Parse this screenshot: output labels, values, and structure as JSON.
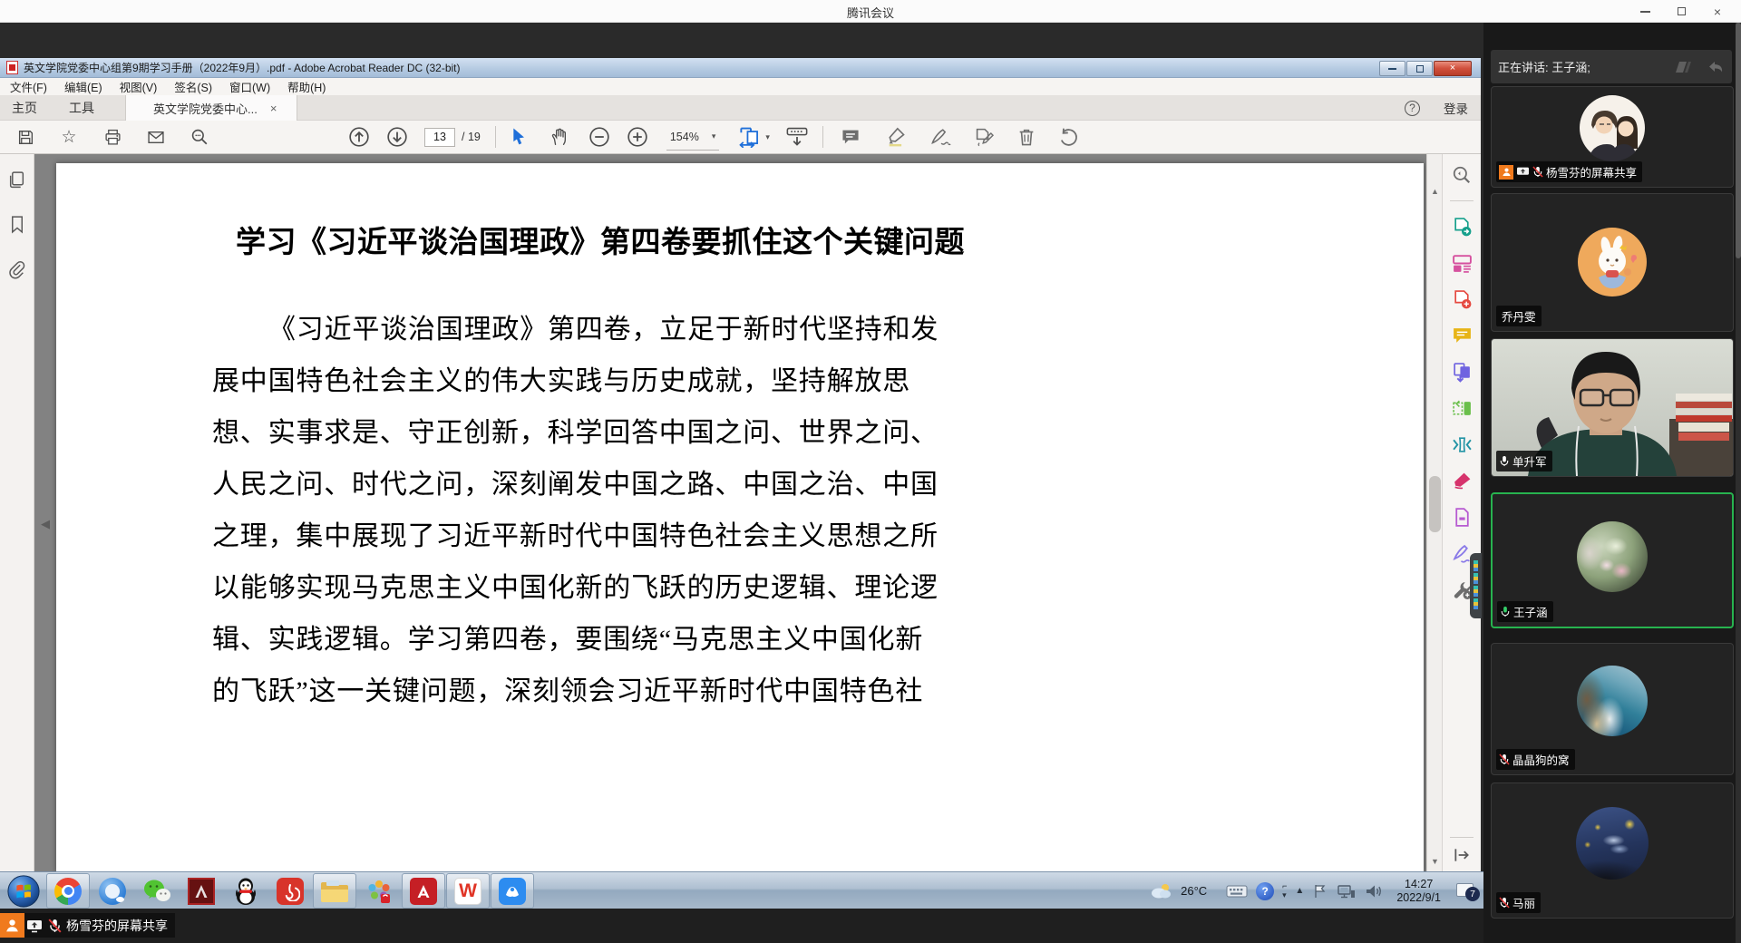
{
  "meeting": {
    "window_title": "腾讯会议",
    "speaking_label": "正在讲话: 王子涵;",
    "share_banner": "杨雪芬的屏幕共享"
  },
  "participants": [
    {
      "name": "杨雪芬的屏幕共享",
      "mic": "muted",
      "role": "sharing-host"
    },
    {
      "name": "乔丹雯",
      "mic": "none"
    },
    {
      "name": "单升军",
      "mic": "on"
    },
    {
      "name": "王子涵",
      "mic": "speaking"
    },
    {
      "name": "晶晶狗的窝",
      "mic": "muted"
    },
    {
      "name": "马丽",
      "mic": "muted"
    }
  ],
  "acrobat": {
    "window_title": "英文学院党委中心组第9期学习手册（2022年9月）.pdf - Adobe Acrobat Reader DC (32-bit)",
    "menus": [
      "文件(F)",
      "编辑(E)",
      "视图(V)",
      "签名(S)",
      "窗口(W)",
      "帮助(H)"
    ],
    "tab_home": "主页",
    "tab_tools": "工具",
    "tab_document": "英文学院党委中心...",
    "sign_in": "登录",
    "page_current": "13",
    "page_total": "/ 19",
    "zoom_level": "154%"
  },
  "document": {
    "title": "学习《习近平谈治国理政》第四卷要抓住这个关键问题",
    "lines": [
      "《习近平谈治国理政》第四卷，立足于新时代坚持和发",
      "展中国特色社会主义的伟大实践与历史成就，坚持解放思",
      "想、实事求是、守正创新，科学回答中国之问、世界之问、",
      "人民之问、时代之问，深刻阐发中国之路、中国之治、中国",
      "之理，集中展现了习近平新时代中国特色社会主义思想之所",
      "以能够实现马克思主义中国化新的飞跃的历史逻辑、理论逻",
      "辑、实践逻辑。学习第四卷，要围绕“马克思主义中国化新",
      "的飞跃”这一关键问题，深刻领会习近平新时代中国特色社"
    ]
  },
  "taskbar": {
    "apps": [
      "start",
      "chrome",
      "qq-browser",
      "wechat",
      "adobe-acrobat",
      "qq",
      "netease-music",
      "file-explorer",
      "app-launcher",
      "adobe-reader",
      "wps-office",
      "tencent-meeting"
    ],
    "temperature": "26°C",
    "time": "14:27",
    "date": "2022/9/1",
    "notification_count": "7"
  },
  "glyphs": {
    "close": "×",
    "minimize": "–",
    "help": "?",
    "star": "☆",
    "caret_down": "▾",
    "scroll_up": "▲",
    "scroll_down": "▼",
    "nav_left": "◀",
    "nav_right": "◀",
    "wps": "W"
  },
  "colors": {
    "speaking_border": "#27b34f",
    "accent_blue": "#1f6fd9",
    "host_badge_orange": "#f07a1d",
    "close_button_red": "#c84b36"
  }
}
